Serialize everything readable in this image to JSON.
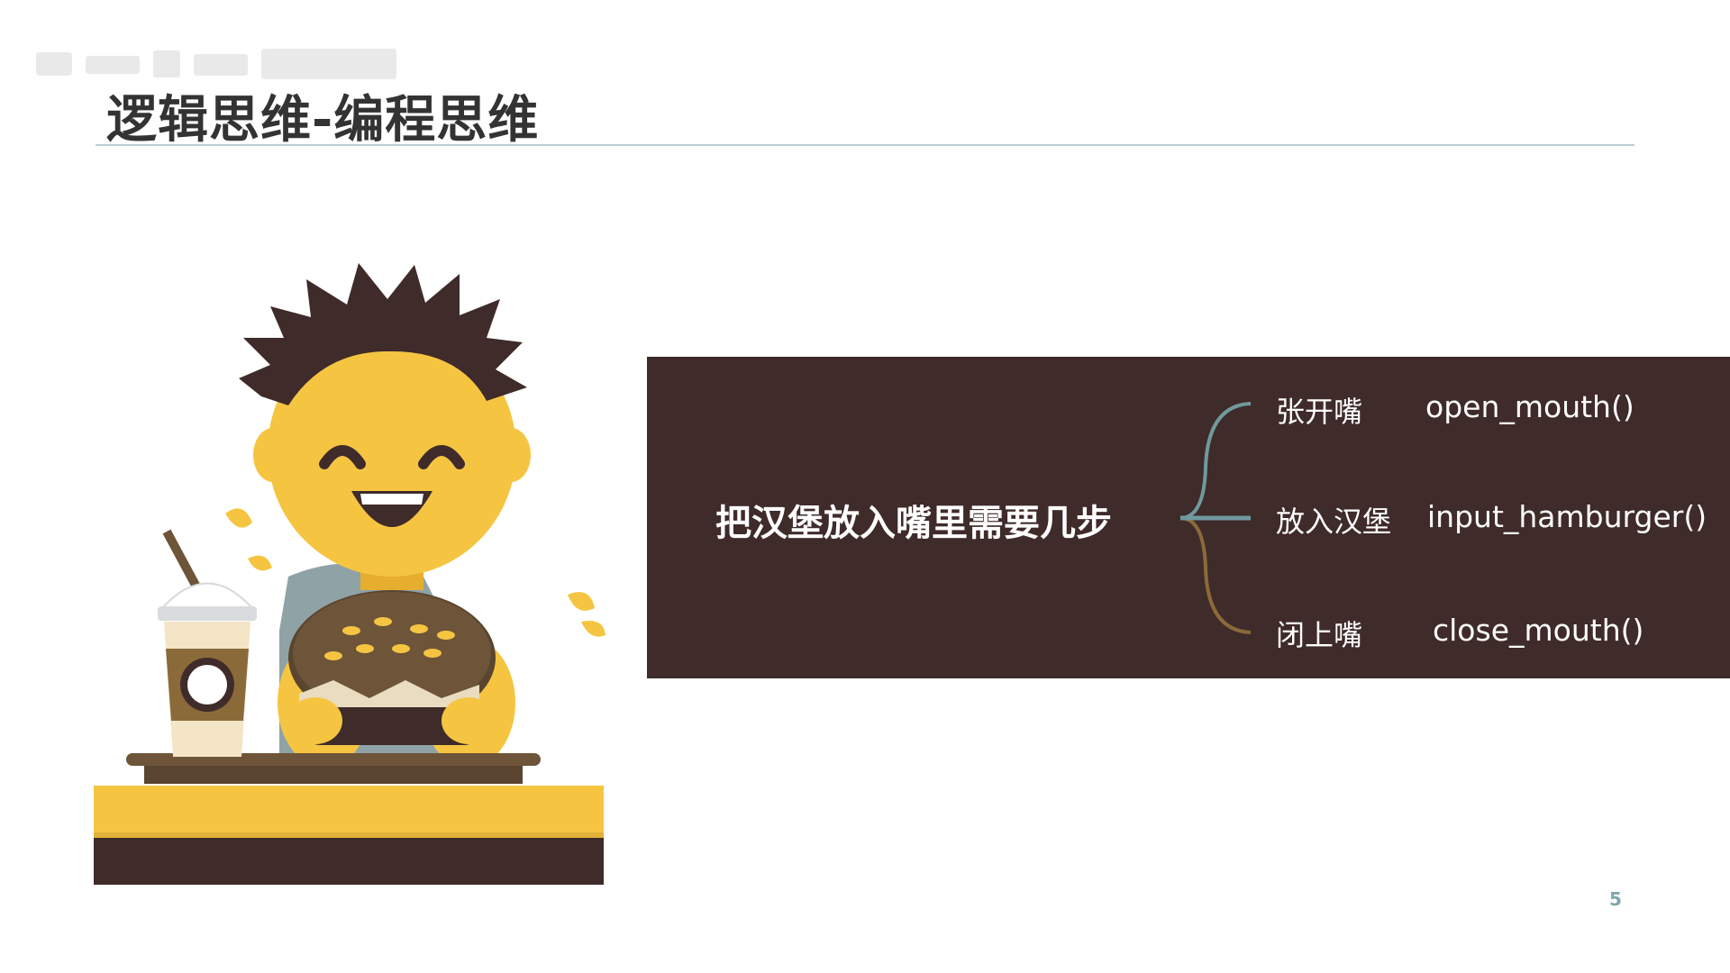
{
  "slide": {
    "title": "逻辑思维-编程思维",
    "page_number": "5"
  },
  "panel": {
    "question": "把汉堡放入嘴里需要几步",
    "steps": [
      {
        "label": "张开嘴",
        "code": "open_mouth()"
      },
      {
        "label": "放入汉堡",
        "code": "input_hamburger()"
      },
      {
        "label": "闭上嘴",
        "code": "close_mouth()"
      }
    ]
  },
  "colors": {
    "panel_bg": "#3f2b2a",
    "accent_yellow": "#f5c542",
    "rule": "#b9cfd3",
    "brace_top": "#6f9a9e",
    "brace_bottom": "#8b6a3a"
  },
  "illustration": {
    "subject": "boy-eating-hamburger"
  }
}
